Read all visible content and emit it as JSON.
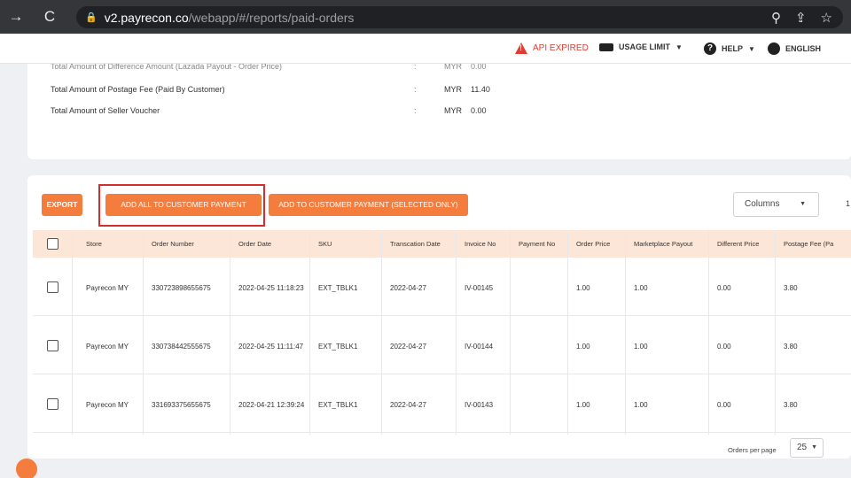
{
  "browser": {
    "url_domain": "v2.payrecon.co",
    "url_path": "/webapp/#/reports/paid-orders"
  },
  "header": {
    "api_status": "API EXPIRED",
    "usage_limit": "USAGE LIMIT",
    "help": "HELP",
    "language": "ENGLISH"
  },
  "summary": {
    "rows": [
      {
        "label": "Total Amount of Difference Amount (Lazada Payout - Order Price)",
        "colon": ":",
        "currency": "MYR",
        "value": "0.00"
      },
      {
        "label": "Total Amount of Postage Fee (Paid By Customer)",
        "colon": ":",
        "currency": "MYR",
        "value": "11.40"
      },
      {
        "label": "Total Amount of Seller Voucher",
        "colon": ":",
        "currency": "MYR",
        "value": "0.00"
      }
    ]
  },
  "toolbar": {
    "export_label": "EXPORT",
    "add_all_label": "ADD ALL TO CUSTOMER PAYMENT",
    "add_selected_label": "ADD TO CUSTOMER PAYMENT (SELECTED ONLY)",
    "columns_label": "Columns",
    "stray_char": "1"
  },
  "table": {
    "headers": [
      "Store",
      "Order Number",
      "Order Date",
      "SKU",
      "Transcation Date",
      "Invoice No",
      "Payment No",
      "Order Price",
      "Marketplace Payout",
      "Different Price",
      "Postage Fee (Pa"
    ],
    "rows": [
      {
        "store": "Payrecon MY",
        "order_number": "330723898655675",
        "order_date": "2022-04-25 11:18:23",
        "sku": "EXT_TBLK1",
        "transaction_date": "2022-04-27",
        "invoice_no": "IV-00145",
        "payment_no": "",
        "order_price": "1.00",
        "marketplace_payout": "1.00",
        "different_price": "0.00",
        "postage_fee": "3.80"
      },
      {
        "store": "Payrecon MY",
        "order_number": "330738442555675",
        "order_date": "2022-04-25 11:11:47",
        "sku": "EXT_TBLK1",
        "transaction_date": "2022-04-27",
        "invoice_no": "IV-00144",
        "payment_no": "",
        "order_price": "1.00",
        "marketplace_payout": "1.00",
        "different_price": "0.00",
        "postage_fee": "3.80"
      },
      {
        "store": "Payrecon MY",
        "order_number": "331693375655675",
        "order_date": "2022-04-21 12:39:24",
        "sku": "EXT_TBLK1",
        "transaction_date": "2022-04-27",
        "invoice_no": "IV-00143",
        "payment_no": "",
        "order_price": "1.00",
        "marketplace_payout": "1.00",
        "different_price": "0.00",
        "postage_fee": "3.80"
      }
    ]
  },
  "pagination": {
    "label": "Orders per page",
    "value": "25"
  },
  "colors": {
    "accent": "#f47c3c",
    "table_header_bg": "#fce6d8",
    "api_expired": "#e03c31",
    "highlight_box": "#d62c2c"
  }
}
